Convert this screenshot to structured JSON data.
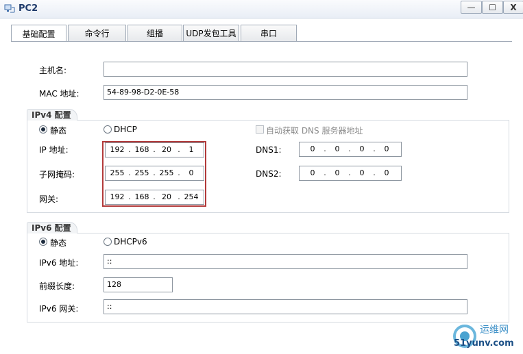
{
  "window": {
    "title": "PC2",
    "controls": [
      "—",
      "☐",
      "X"
    ]
  },
  "tabs": [
    "基础配置",
    "命令行",
    "组播",
    "UDP发包工具",
    "串口"
  ],
  "basic": {
    "hostname_label": "主机名:",
    "hostname_value": "",
    "mac_label": "MAC 地址:",
    "mac_value": "54-89-98-D2-0E-58"
  },
  "ipv4": {
    "title": "IPv4 配置",
    "static_label": "静态",
    "dhcp_label": "DHCP",
    "auto_dns_label": "自动获取 DNS 服务器地址",
    "ip_label": "IP 地址:",
    "ip": [
      "192",
      "168",
      "20",
      "1"
    ],
    "mask_label": "子网掩码:",
    "mask": [
      "255",
      "255",
      "255",
      "0"
    ],
    "gateway_label": "网关:",
    "gateway": [
      "192",
      "168",
      "20",
      "254"
    ],
    "dns1_label": "DNS1:",
    "dns1": [
      "0",
      "0",
      "0",
      "0"
    ],
    "dns2_label": "DNS2:",
    "dns2": [
      "0",
      "0",
      "0",
      "0"
    ]
  },
  "ipv6": {
    "title": "IPv6 配置",
    "static_label": "静态",
    "dhcp_label": "DHCPv6",
    "addr_label": "IPv6 地址:",
    "addr_value": "::",
    "prefix_label": "前缀长度:",
    "prefix_value": "128",
    "gateway_label": "IPv6 网关:",
    "gateway_value": "::"
  },
  "watermark": {
    "line1": "运维网",
    "line2": "51yunv.com"
  },
  "colors": {
    "highlight": "#b23a3a",
    "title": "#1e3a6a"
  }
}
